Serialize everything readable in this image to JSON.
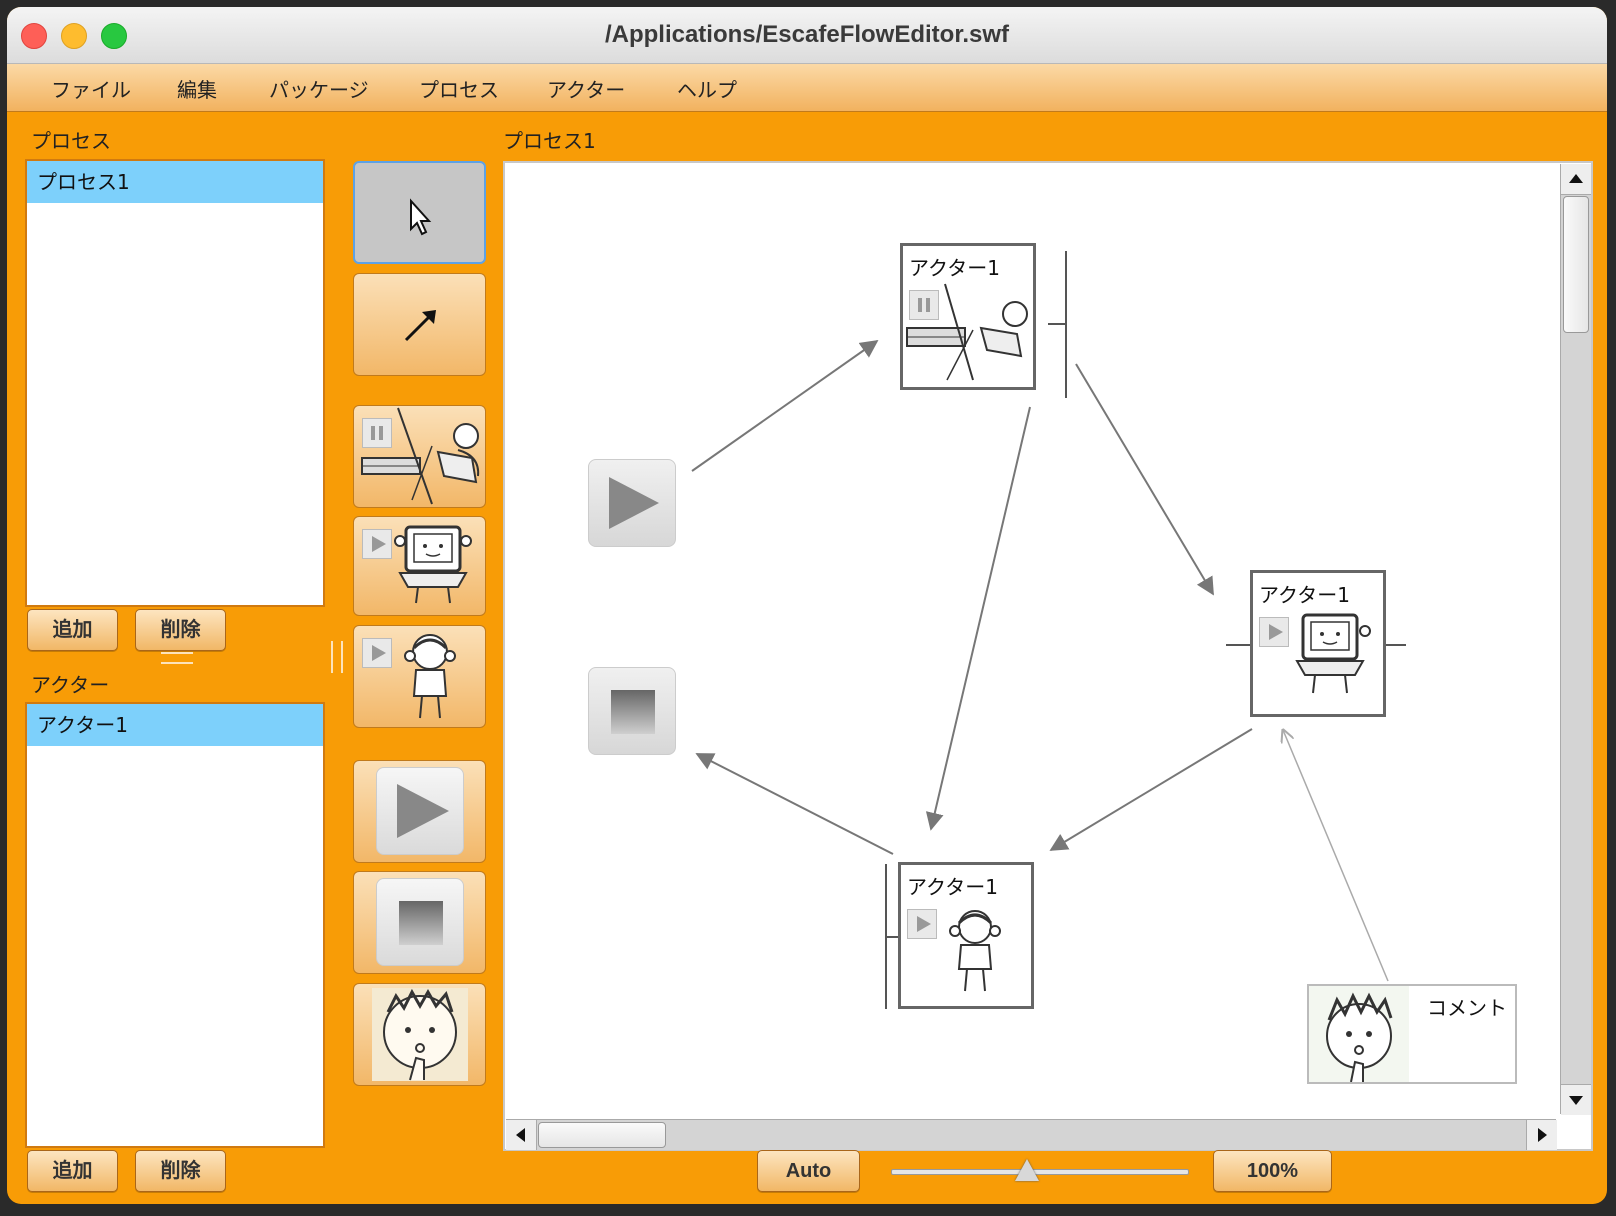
{
  "window": {
    "title": "/Applications/EscafeFlowEditor.swf"
  },
  "menu": [
    "ファイル",
    "編集",
    "パッケージ",
    "プロセス",
    "アクター",
    "ヘルプ"
  ],
  "process_panel": {
    "heading": "プロセス",
    "items": [
      "プロセス1"
    ],
    "selected": "プロセス1",
    "add_label": "追加",
    "delete_label": "削除"
  },
  "actor_panel": {
    "heading": "アクター",
    "items": [
      "アクター1"
    ],
    "selected": "アクター1",
    "add_label": "追加",
    "delete_label": "削除"
  },
  "palette": [
    "select-tool",
    "connect-tool",
    "server-actor-tool",
    "computer-actor-tool",
    "person-actor-tool",
    "start-tool",
    "stop-tool",
    "comment-tool"
  ],
  "canvas": {
    "title": "プロセス1",
    "nodes": [
      {
        "label": "アクター1",
        "kind": "server-actor",
        "state": "paused"
      },
      {
        "label": "アクター1",
        "kind": "computer-actor",
        "state": "play"
      },
      {
        "label": "アクター1",
        "kind": "person-actor",
        "state": "play"
      }
    ],
    "comment": "コメント"
  },
  "footer": {
    "auto_label": "Auto",
    "zoom_label": "100%",
    "zoom_slider_fraction": 0.46
  },
  "colors": {
    "background": "#f89c06",
    "selection": "#7dd0fb",
    "canvas": "#ffffff"
  }
}
